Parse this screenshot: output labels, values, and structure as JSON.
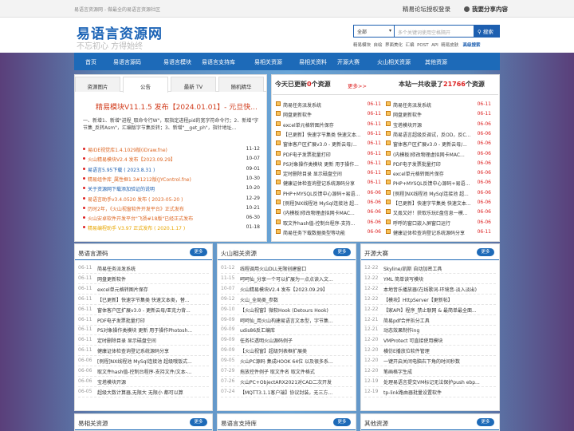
{
  "topbar": {
    "left": "易语言资源网 - 做最全的易语言资源社区",
    "login": "精易论坛授权登录",
    "share": "我要分享内容"
  },
  "header": {
    "logo": "易语言资源网",
    "slogan": "不忘初心 方得始终"
  },
  "search": {
    "category": "全部",
    "placeholder": "多个关键词使用空格隔开",
    "button": "搜索",
    "hot": [
      "精易模块",
      "自绘",
      "界面美化",
      "汇编",
      "POST",
      "API",
      "精易皮肤"
    ],
    "advanced": "高级搜索"
  },
  "nav": [
    "首页",
    "易语言源码",
    "易语言模块",
    "易语言支持库",
    "易相关资源",
    "易相关资料",
    "开源大赛",
    "火山相关资源",
    "其他资源"
  ],
  "tabs": [
    "资源图片",
    "公告",
    "最新 TV",
    "随机精华"
  ],
  "release": {
    "title": "精易模块V11.1.5 发布【2024.01.01】- 元旦快...",
    "desc": "一、新增1、新增\"进程_取命令行W\"，取指定进程pid的宽字符命令行；2、新增\"字节集_反转Asm\"，汇编版字节集反转；3、新增\"__get_ph\"，指针地址..."
  },
  "news": [
    {
      "t": "易IDE视觉库1.4.1029版(iDraw.fne)",
      "d": "11-12",
      "c": "#d62"
    },
    {
      "t": "火山精易模块V2.4 发布【2023.09.29】",
      "d": "10-07",
      "c": "#d62"
    },
    {
      "t": "易语言5.95下载 ( 2023.8.31 )",
      "d": "09-01",
      "c": "#1d5fb0"
    },
    {
      "t": "精易组件库_属性框1.3#1212版(JYControl.fne)",
      "d": "10-30",
      "c": "#d62"
    },
    {
      "t": "关于资源网下载添加验证的说明",
      "d": "10-20",
      "c": "#1d5fb0"
    },
    {
      "t": "易语言助手v3.4.0520 发布 ( 2023-05-20 )",
      "d": "12-29",
      "c": "#d62"
    },
    {
      "t": "历时2年，《火山视窗软件开发平台》正式发布",
      "d": "10-21",
      "c": "#d62"
    },
    {
      "t": "火山安卓软件开发平台\"飞扬#18版\"已经正式发布",
      "d": "06-30",
      "c": "#d62"
    },
    {
      "t": "精易编程助手 V3.97 正式发布 ( 2020.1.17 )",
      "d": "01-18",
      "c": "#e9a600"
    }
  ],
  "today": {
    "pre": "今天已更新",
    "count": "0",
    "post": "个资源",
    "more": "更多>>",
    "total_pre": "本站一共收录了",
    "total": "21766",
    "total_post": "个资源"
  },
  "today_left": [
    {
      "t": "简易任务派发系统",
      "d": "06-11"
    },
    {
      "t": "网盘更新软件",
      "d": "06-11"
    },
    {
      "t": "excel单元格转图片保存",
      "d": "06-11"
    },
    {
      "t": "【已更新】快速字节集类 快速文本...",
      "d": "06-11"
    },
    {
      "t": "窗体客户区扩展v3.0 - 更新云母/...",
      "d": "06-11"
    },
    {
      "t": "PDF电子发票批量打印",
      "d": "06-11"
    },
    {
      "t": "PS对象操作类模块 更新 用于操作...",
      "d": "06-11"
    },
    {
      "t": "定时删除目录 显示磁盘空间",
      "d": "06-11"
    },
    {
      "t": "健康证体检查询登记系统源码分享",
      "d": "06-11"
    },
    {
      "t": "PHP+MYSQL反馈中心源码+易语...",
      "d": "06-06"
    },
    {
      "t": "[例程]NX线程池 MySql连接池 超...",
      "d": "06-06"
    },
    {
      "t": "(内模板)修改物理虚拟网卡MAC...",
      "d": "06-06"
    },
    {
      "t": "取文件hash值-控制台程序-支持...",
      "d": "06-06"
    },
    {
      "t": "简易任务下载数据类型等功能",
      "d": "06-06"
    }
  ],
  "today_right": [
    {
      "t": "简易任务派发系统",
      "d": "06-11"
    },
    {
      "t": "网盘更新软件",
      "d": "06-11"
    },
    {
      "t": "宝塔模块开源",
      "d": "06-06"
    },
    {
      "t": "简易语言超级反调试，反OD，反C...",
      "d": "06-06"
    },
    {
      "t": "窗体客户区扩展v3.0 - 更新云母/...",
      "d": "06-06"
    },
    {
      "t": "(内模板)修改物理虚拟网卡MAC...",
      "d": "06-06"
    },
    {
      "t": "PDF电子发票批量打印",
      "d": "06-06"
    },
    {
      "t": "excel单元格转图片保存",
      "d": "06-06"
    },
    {
      "t": "PHP+MYSQL反馈中心源码+易语...",
      "d": "06-06"
    },
    {
      "t": "[例程]NX线程池 MySql连接池 超...",
      "d": "06-06"
    },
    {
      "t": "【已更新】快速字节集类 快速文本...",
      "d": "06-06"
    },
    {
      "t": "又叒又好！获取乐玩E盘信息一模...",
      "d": "06-06"
    },
    {
      "t": "呼呼的窗口嵌入屏窗口运行",
      "d": "06-06"
    },
    {
      "t": "健康证体检查询登记系统源码分享",
      "d": "06-11"
    }
  ],
  "sections": [
    {
      "title": "易语言源码",
      "more": "更多",
      "rows": [
        {
          "d": "06-11",
          "t": "简易任务派发系统"
        },
        {
          "d": "06-11",
          "t": "网盘更新软件"
        },
        {
          "d": "06-11",
          "t": "excel单元格转图片保存"
        },
        {
          "d": "06-11",
          "t": "【已更新】快速字节集类 快速文本类，替..."
        },
        {
          "d": "06-11",
          "t": "窗体客户区扩展v3.0 - 更新云母/亚克力背..."
        },
        {
          "d": "06-11",
          "t": "PDF电子发票批量打印"
        },
        {
          "d": "06-11",
          "t": "PS对象操作类模块 更新 用于操作Photosh..."
        },
        {
          "d": "06-11",
          "t": "定时删除目录 显示磁盘空间"
        },
        {
          "d": "06-11",
          "t": "健康证体检查询登记系统源码分享"
        },
        {
          "d": "06-06",
          "t": "[例程]NX线程池 MySql连接池 超级哦饭式..."
        },
        {
          "d": "06-06",
          "t": "取文件hash值-控制台程序-支持文件/文本-..."
        },
        {
          "d": "06-06",
          "t": "宝塔模块开源"
        },
        {
          "d": "06-05",
          "t": "超级大数计算器,无限大 无限小 都可以算"
        }
      ]
    },
    {
      "title": "火山相关资源",
      "more": "更多",
      "rows": [
        {
          "d": "01-12",
          "t": "线程调用火山DLL无限创建窗口"
        },
        {
          "d": "11-15",
          "t": "呵呵仙_分享一个可以扩展为一点点读入文..."
        },
        {
          "d": "10-07",
          "t": "火山精易模块V2.4 发布【2023.09.29】"
        },
        {
          "d": "09-12",
          "t": "火山_全局类_参数"
        },
        {
          "d": "09-10",
          "t": "【火山视窗】微软Hook (Detours Hook)"
        },
        {
          "d": "09-09",
          "t": "呵呵仙_用火山构建易语言文本型，字节集..."
        },
        {
          "d": "09-09",
          "t": "udis86反汇编库"
        },
        {
          "d": "09-09",
          "t": "任务栏透明火山源码例子"
        },
        {
          "d": "09-09",
          "t": "【火山视窗】超级列表框扩展类"
        },
        {
          "d": "09-05",
          "t": "火山PC源码 集成HOOK 64位 以及很多系..."
        },
        {
          "d": "07-29",
          "t": "拖放控件例子 取文件名 取文件格式"
        },
        {
          "d": "07-26",
          "t": "火山PC+ObjectARX2021对CAD二次开发"
        },
        {
          "d": "07-24",
          "t": "【MQTT3.1.1客户端】协议封装，无三方..."
        }
      ]
    },
    {
      "title": "开源大赛",
      "more": "更多",
      "rows": [
        {
          "d": "12-22",
          "t": "Skyline/凯斯 自动加密工具"
        },
        {
          "d": "12-22",
          "t": "YML 简单读写模块"
        },
        {
          "d": "12-22",
          "t": "本地音乐播放器(在线歌词-环境音-淡入淡出)"
        },
        {
          "d": "12-22",
          "t": "【模块】HttpServer【更新帖】"
        },
        {
          "d": "12-22",
          "t": "【家API】程序_禁止联网 & 最简单最全面..."
        },
        {
          "d": "12-21",
          "t": "简易pdf合并拆分工具"
        },
        {
          "d": "12-21",
          "t": "动态效果制作ing"
        },
        {
          "d": "12-20",
          "t": "VMProtect 可直接使用模块"
        },
        {
          "d": "12-20",
          "t": "横仿E播放位软件管理"
        },
        {
          "d": "12-20",
          "t": "一键开启关闭电脑右下角的时间秒数"
        },
        {
          "d": "12-20",
          "t": "笔画格字生成"
        },
        {
          "d": "12-19",
          "t": "处理易语言提交VM标记无法保护push ebp..."
        },
        {
          "d": "12-19",
          "t": "tp-link路由器批量设置软件"
        }
      ]
    }
  ],
  "bottom_sections": [
    {
      "title": "易相关资源",
      "more": "更多"
    },
    {
      "title": "易语言支持库",
      "more": "更多"
    },
    {
      "title": "其他资源",
      "more": "更多"
    }
  ]
}
